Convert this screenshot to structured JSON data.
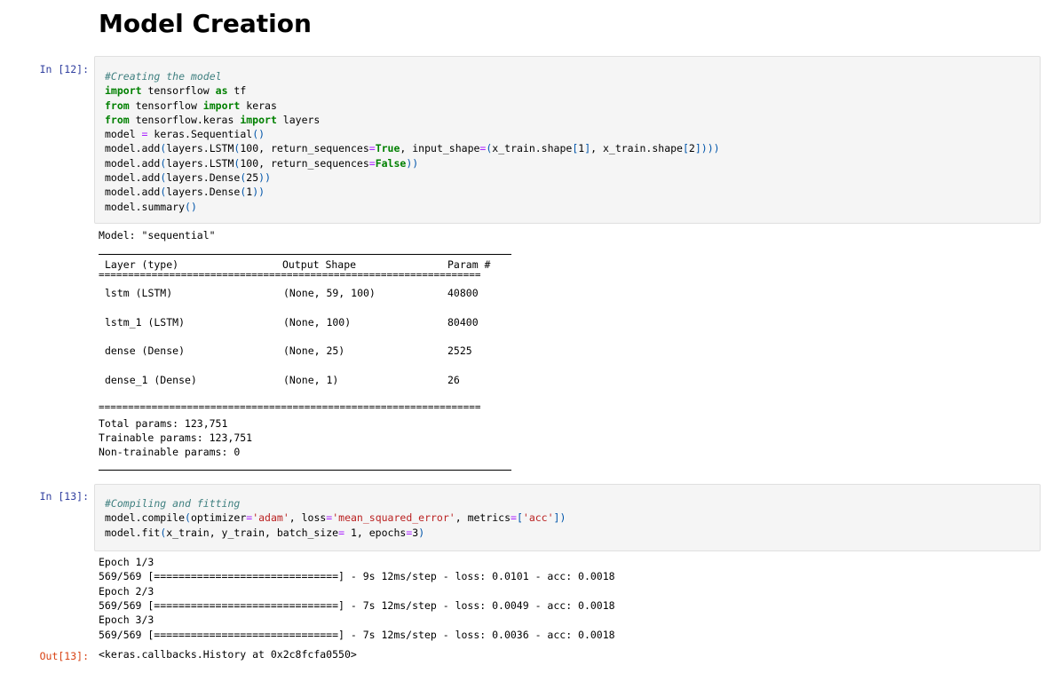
{
  "heading": "Model Creation",
  "cell12": {
    "prompt": "In [12]:",
    "summary": {
      "model_line": "Model: \"sequential\"",
      "header": {
        "layer": "Layer (type)",
        "output": "Output Shape",
        "param": "Param #"
      },
      "eq_rule": "=================================================================",
      "rows": [
        {
          "layer": "lstm (LSTM)",
          "output": "(None, 59, 100)",
          "param": "40800"
        },
        {
          "layer": "lstm_1 (LSTM)",
          "output": "(None, 100)",
          "param": "80400"
        },
        {
          "layer": "dense (Dense)",
          "output": "(None, 25)",
          "param": "2525"
        },
        {
          "layer": "dense_1 (Dense)",
          "output": "(None, 1)",
          "param": "26"
        }
      ],
      "total": "Total params: 123,751",
      "trainable": "Trainable params: 123,751",
      "non_trainable": "Non-trainable params: 0"
    }
  },
  "cell13": {
    "prompt": "In [13]:",
    "out_prompt": "Out[13]:",
    "output_lines": [
      "Epoch 1/3",
      "569/569 [==============================] - 9s 12ms/step - loss: 0.0101 - acc: 0.0018",
      "Epoch 2/3",
      "569/569 [==============================] - 7s 12ms/step - loss: 0.0049 - acc: 0.0018",
      "Epoch 3/3",
      "569/569 [==============================] - 7s 12ms/step - loss: 0.0036 - acc: 0.0018"
    ],
    "result": "<keras.callbacks.History at 0x2c8fcfa0550>"
  },
  "code_lines": [
    "#Creating the model",
    "import tensorflow as tf",
    "from tensorflow import keras",
    "from tensorflow.keras import layers",
    "model = keras.Sequential()",
    "model.add(layers.LSTM(100, return_sequences=True, input_shape=(x_train.shape[1], x_train.shape[2])))",
    "model.add(layers.LSTM(100, return_sequences=False))",
    "model.add(layers.Dense(25))",
    "model.add(layers.Dense(1))",
    "model.summary()",
    "#Compiling and fitting",
    "model.compile(optimizer='adam', loss='mean_squared_error', metrics=['acc'])",
    "model.fit(x_train, y_train, batch_size= 1, epochs=3)"
  ],
  "colors": {
    "input_prompt": "#303f9f",
    "output_prompt": "#d84315",
    "cell_bg": "#f5f5f5"
  }
}
